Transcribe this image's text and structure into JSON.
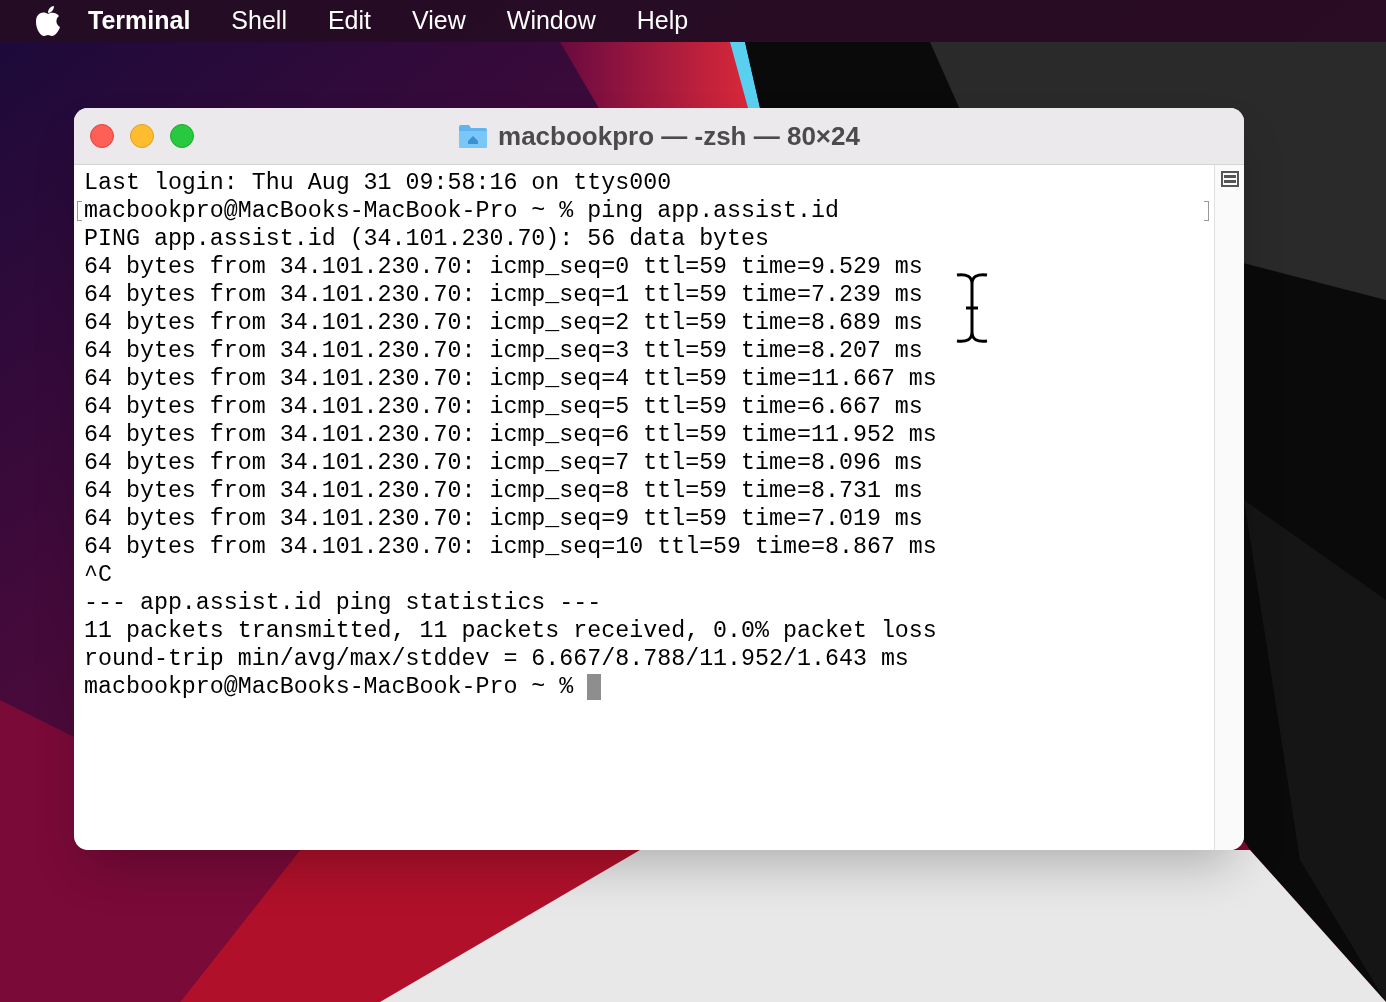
{
  "menu_bar": [
    {
      "label": "Terminal",
      "kind": "app"
    },
    {
      "label": "Shell",
      "kind": "menu"
    },
    {
      "label": "Edit",
      "kind": "menu"
    },
    {
      "label": "View",
      "kind": "menu"
    },
    {
      "label": "Window",
      "kind": "menu"
    },
    {
      "label": "Help",
      "kind": "menu"
    }
  ],
  "window": {
    "title": "macbookpro — -zsh — 80×24"
  },
  "terminal": {
    "cursor_visible": true,
    "lines": [
      {
        "text": "Last login: Thu Aug 31 09:58:16 on ttys000",
        "marked": false
      },
      {
        "text": "macbookpro@MacBooks-MacBook-Pro ~ % ping app.assist.id",
        "marked": true
      },
      {
        "text": "PING app.assist.id (34.101.230.70): 56 data bytes",
        "marked": false
      },
      {
        "text": "64 bytes from 34.101.230.70: icmp_seq=0 ttl=59 time=9.529 ms",
        "marked": false
      },
      {
        "text": "64 bytes from 34.101.230.70: icmp_seq=1 ttl=59 time=7.239 ms",
        "marked": false
      },
      {
        "text": "64 bytes from 34.101.230.70: icmp_seq=2 ttl=59 time=8.689 ms",
        "marked": false
      },
      {
        "text": "64 bytes from 34.101.230.70: icmp_seq=3 ttl=59 time=8.207 ms",
        "marked": false
      },
      {
        "text": "64 bytes from 34.101.230.70: icmp_seq=4 ttl=59 time=11.667 ms",
        "marked": false
      },
      {
        "text": "64 bytes from 34.101.230.70: icmp_seq=5 ttl=59 time=6.667 ms",
        "marked": false
      },
      {
        "text": "64 bytes from 34.101.230.70: icmp_seq=6 ttl=59 time=11.952 ms",
        "marked": false
      },
      {
        "text": "64 bytes from 34.101.230.70: icmp_seq=7 ttl=59 time=8.096 ms",
        "marked": false
      },
      {
        "text": "64 bytes from 34.101.230.70: icmp_seq=8 ttl=59 time=8.731 ms",
        "marked": false
      },
      {
        "text": "64 bytes from 34.101.230.70: icmp_seq=9 ttl=59 time=7.019 ms",
        "marked": false
      },
      {
        "text": "64 bytes from 34.101.230.70: icmp_seq=10 ttl=59 time=8.867 ms",
        "marked": false
      },
      {
        "text": "^C",
        "marked": false
      },
      {
        "text": "--- app.assist.id ping statistics ---",
        "marked": false
      },
      {
        "text": "11 packets transmitted, 11 packets received, 0.0% packet loss",
        "marked": false
      },
      {
        "text": "round-trip min/avg/max/stddev = 6.667/8.788/11.952/1.643 ms",
        "marked": false
      },
      {
        "text": "macbookpro@MacBooks-MacBook-Pro ~ % ",
        "marked": false
      }
    ]
  }
}
